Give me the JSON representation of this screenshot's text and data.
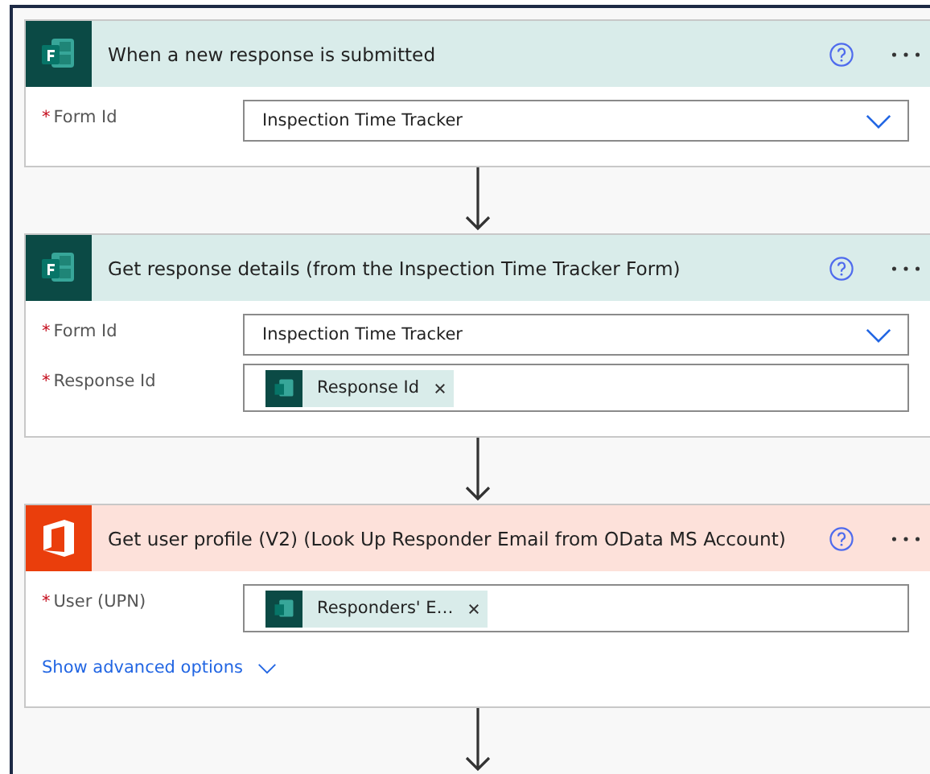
{
  "steps": [
    {
      "kind": "forms",
      "title": "When a new response is submitted",
      "fields": [
        {
          "mark": "*",
          "label": "Form Id",
          "kind": "dropdown",
          "value": "Inspection Time Tracker"
        }
      ]
    },
    {
      "kind": "forms",
      "title": "Get response details (from the Inspection Time Tracker Form)",
      "fields": [
        {
          "mark": "*",
          "label": "Form Id",
          "kind": "dropdown",
          "value": "Inspection Time Tracker"
        },
        {
          "mark": "*",
          "label": "Response Id",
          "kind": "token",
          "token": "Response Id"
        }
      ]
    },
    {
      "kind": "office",
      "title": "Get user profile (V2) (Look Up Responder Email from OData MS Account)",
      "fields": [
        {
          "mark": "*",
          "label": "User (UPN)",
          "kind": "token",
          "token": "Responders' E…"
        }
      ],
      "advanced_link": "Show advanced options"
    }
  ]
}
